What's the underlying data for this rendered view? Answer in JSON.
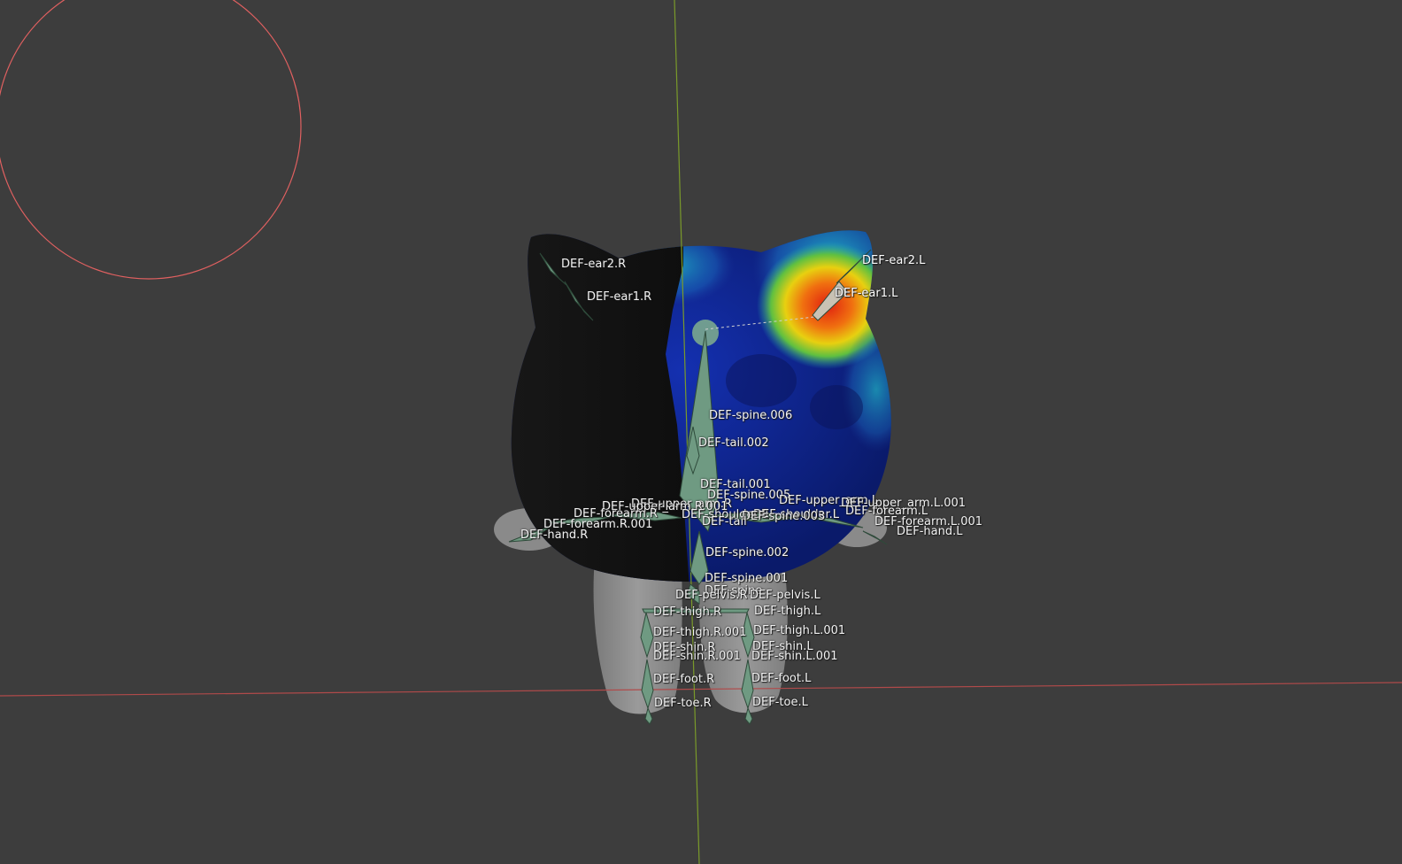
{
  "viewport": {
    "background": "#3d3d3d",
    "x_axis_color": "#b04a4a",
    "y_axis_color": "#7a9a2a",
    "brush_circle_color": "#e06060",
    "bone_color": "#6f9a82",
    "selected_bone_color": "#c9c2b4"
  },
  "bones": [
    {
      "name": "DEF-ear2.R"
    },
    {
      "name": "DEF-ear1.R"
    },
    {
      "name": "DEF-ear2.L"
    },
    {
      "name": "DEF-ear1.L"
    },
    {
      "name": "DEF-spine.006"
    },
    {
      "name": "DEF-tail.002"
    },
    {
      "name": "DEF-tail.001"
    },
    {
      "name": "DEF-spine.005"
    },
    {
      "name": "DEF-upper_arm.R"
    },
    {
      "name": "DEF-upper_arm.R.001"
    },
    {
      "name": "DEF-forearm.R"
    },
    {
      "name": "DEF-forearm.R.001"
    },
    {
      "name": "DEF-hand.R"
    },
    {
      "name": "DEF-shoulder.R"
    },
    {
      "name": "DEF-shoulder.L"
    },
    {
      "name": "DEF-spine.003"
    },
    {
      "name": "DEF-tail"
    },
    {
      "name": "DEF-upper_arm.L"
    },
    {
      "name": "DEF-upper_arm.L.001"
    },
    {
      "name": "DEF-forearm.L"
    },
    {
      "name": "DEF-forearm.L.001"
    },
    {
      "name": "DEF-hand.L"
    },
    {
      "name": "DEF-spine.002"
    },
    {
      "name": "DEF-spine.001"
    },
    {
      "name": "DEF-spine"
    },
    {
      "name": "DEF-pelvis.R"
    },
    {
      "name": "DEF-pelvis.L"
    },
    {
      "name": "DEF-thigh.R"
    },
    {
      "name": "DEF-thigh.L"
    },
    {
      "name": "DEF-thigh.R.001"
    },
    {
      "name": "DEF-thigh.L.001"
    },
    {
      "name": "DEF-shin.R"
    },
    {
      "name": "DEF-shin.L"
    },
    {
      "name": "DEF-shin.R.001"
    },
    {
      "name": "DEF-shin.L.001"
    },
    {
      "name": "DEF-foot.R"
    },
    {
      "name": "DEF-foot.L"
    },
    {
      "name": "DEF-toe.R"
    },
    {
      "name": "DEF-toe.L"
    }
  ]
}
